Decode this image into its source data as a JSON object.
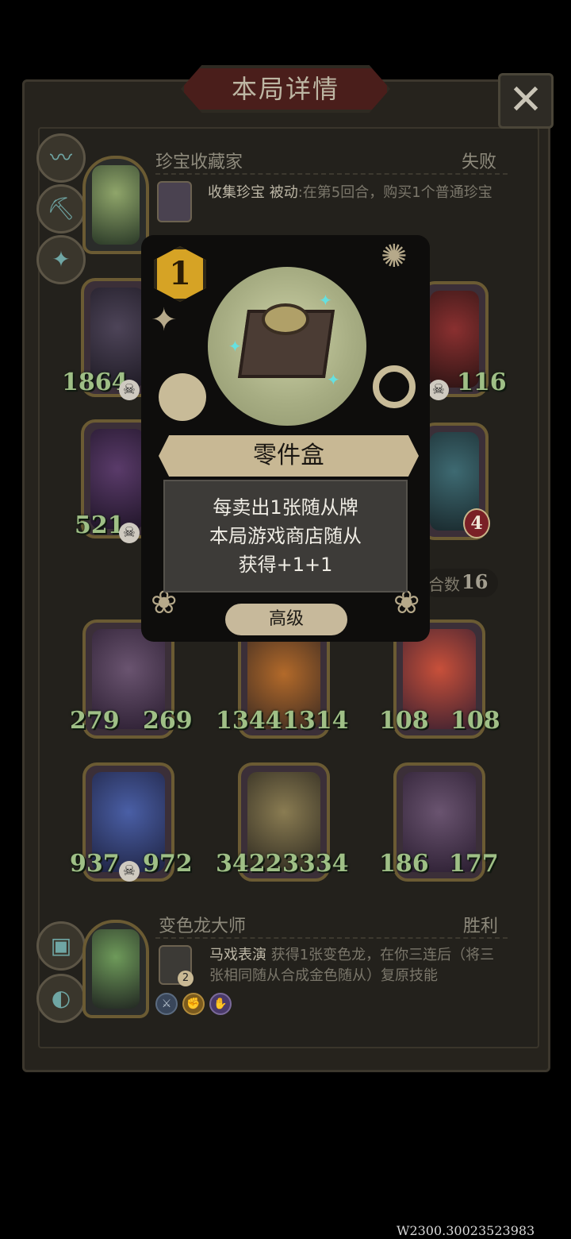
{
  "header": {
    "title": "本局详情",
    "close_icon": "✕"
  },
  "opponent": {
    "name": "珍宝收藏家",
    "result": "失败",
    "skill_name": "收集珍宝",
    "skill_type": "被动",
    "skill_desc": ":在第5回合，购买1个普通珍宝"
  },
  "board_top": {
    "stats": [
      "1864",
      "116",
      "521",
      "4"
    ]
  },
  "board_bottom": {
    "count_label": "合数",
    "count_value": "16",
    "row1": [
      {
        "atk": "279",
        "hp": "269"
      },
      {
        "atk": "1344",
        "hp": "1314"
      },
      {
        "atk": "108",
        "hp": "108"
      }
    ],
    "row2": [
      {
        "atk": "937",
        "hp": "972"
      },
      {
        "atk": "3422",
        "hp": "3334"
      },
      {
        "atk": "186",
        "hp": "177"
      }
    ]
  },
  "player": {
    "name": "变色龙大师",
    "result": "胜利",
    "skill_name": "马戏表演",
    "skill_desc": "获得1张变色龙，在你三连后（将三张相同随从合成金色随从）复原技能",
    "skill_badge": "2"
  },
  "card": {
    "cost": "1",
    "name": "零件盒",
    "desc_line1": "每卖出1张随从牌",
    "desc_line2": "本局游戏商店随从",
    "desc_line3": "获得+1+1",
    "tier": "高级"
  },
  "watermark": "W2300.30023523983"
}
